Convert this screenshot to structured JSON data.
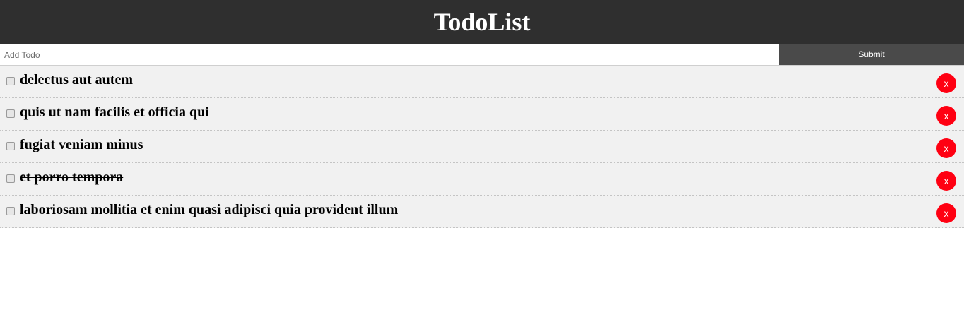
{
  "header": {
    "title": "TodoList"
  },
  "form": {
    "placeholder": "Add Todo",
    "value": "",
    "submit_label": "Submit"
  },
  "todos": [
    {
      "text": "delectus aut autem",
      "done": false,
      "delete_label": "x"
    },
    {
      "text": "quis ut nam facilis et officia qui",
      "done": false,
      "delete_label": "x"
    },
    {
      "text": "fugiat veniam minus",
      "done": false,
      "delete_label": "x"
    },
    {
      "text": "et porro tempora",
      "done": true,
      "delete_label": "x"
    },
    {
      "text": "laboriosam mollitia et enim quasi adipisci quia provident illum",
      "done": false,
      "delete_label": "x"
    }
  ],
  "colors": {
    "header_bg": "#2f2f2f",
    "submit_bg": "#4a4a4a",
    "row_bg": "#f1f1f1",
    "delete_bg": "#ff0012"
  }
}
